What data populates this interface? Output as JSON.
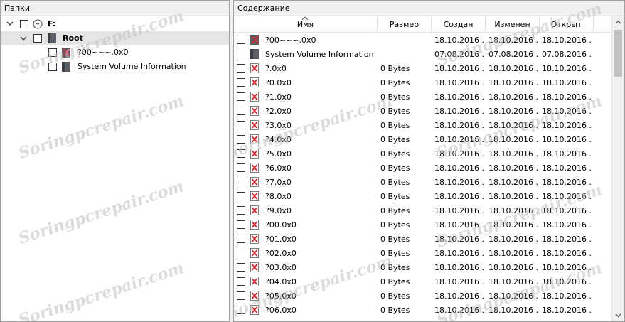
{
  "folders_pane": {
    "title": "Папки",
    "tree": [
      {
        "label": "F:",
        "level": 0,
        "icon": "drive-icon",
        "bold": true
      },
      {
        "label": "Root",
        "level": 1,
        "icon": "folder-icon",
        "bold": true,
        "selected": true
      },
      {
        "label": "?00~~~.0x0",
        "level": 2,
        "icon": "deleted-folder-icon",
        "bold": false
      },
      {
        "label": "System Volume Information",
        "level": 2,
        "icon": "folder-icon",
        "bold": false
      }
    ]
  },
  "content_pane": {
    "title": "Содержание",
    "columns": {
      "name": "Имя",
      "size": "Размер",
      "created": "Создан",
      "modified": "Изменен",
      "opened": "Открыт"
    },
    "rows": [
      {
        "name": "?00~~~.0x0",
        "size": "",
        "created": "18.10.2016 ...",
        "modified": "18.10.2016 ...",
        "opened": "18.10.2016 ...",
        "icon": "deleted-folder-icon"
      },
      {
        "name": "System Volume Information",
        "size": "",
        "created": "07.08.2016 ...",
        "modified": "07.08.2016 ...",
        "opened": "07.08.2016 ...",
        "icon": "folder-icon"
      },
      {
        "name": "?.0x0",
        "size": "0 Bytes",
        "created": "18.10.2016 ...",
        "modified": "18.10.2016 ...",
        "opened": "18.10.2016 ...",
        "icon": "deleted-file-icon"
      },
      {
        "name": "?0.0x0",
        "size": "0 Bytes",
        "created": "18.10.2016 ...",
        "modified": "18.10.2016 ...",
        "opened": "18.10.2016 ...",
        "icon": "deleted-file-icon"
      },
      {
        "name": "?1.0x0",
        "size": "0 Bytes",
        "created": "18.10.2016 ...",
        "modified": "18.10.2016 ...",
        "opened": "18.10.2016 ...",
        "icon": "deleted-file-icon"
      },
      {
        "name": "?2.0x0",
        "size": "0 Bytes",
        "created": "18.10.2016 ...",
        "modified": "18.10.2016 ...",
        "opened": "18.10.2016 ...",
        "icon": "deleted-file-icon"
      },
      {
        "name": "?3.0x0",
        "size": "0 Bytes",
        "created": "18.10.2016 ...",
        "modified": "18.10.2016 ...",
        "opened": "18.10.2016 ...",
        "icon": "deleted-file-icon"
      },
      {
        "name": "?4.0x0",
        "size": "0 Bytes",
        "created": "18.10.2016 ...",
        "modified": "18.10.2016 ...",
        "opened": "18.10.2016 ...",
        "icon": "deleted-file-icon"
      },
      {
        "name": "?5.0x0",
        "size": "0 Bytes",
        "created": "18.10.2016 ...",
        "modified": "18.10.2016 ...",
        "opened": "18.10.2016 ...",
        "icon": "deleted-file-icon"
      },
      {
        "name": "?6.0x0",
        "size": "0 Bytes",
        "created": "18.10.2016 ...",
        "modified": "18.10.2016 ...",
        "opened": "18.10.2016 ...",
        "icon": "deleted-file-icon"
      },
      {
        "name": "?7.0x0",
        "size": "0 Bytes",
        "created": "18.10.2016 ...",
        "modified": "18.10.2016 ...",
        "opened": "18.10.2016 ...",
        "icon": "deleted-file-icon"
      },
      {
        "name": "?8.0x0",
        "size": "0 Bytes",
        "created": "18.10.2016 ...",
        "modified": "18.10.2016 ...",
        "opened": "18.10.2016 ...",
        "icon": "deleted-file-icon"
      },
      {
        "name": "?9.0x0",
        "size": "0 Bytes",
        "created": "18.10.2016 ...",
        "modified": "18.10.2016 ...",
        "opened": "18.10.2016 ...",
        "icon": "deleted-file-icon"
      },
      {
        "name": "?00.0x0",
        "size": "0 Bytes",
        "created": "18.10.2016 ...",
        "modified": "18.10.2016 ...",
        "opened": "18.10.2016 ...",
        "icon": "deleted-file-icon"
      },
      {
        "name": "?01.0x0",
        "size": "0 Bytes",
        "created": "18.10.2016 ...",
        "modified": "18.10.2016 ...",
        "opened": "18.10.2016 ...",
        "icon": "deleted-file-icon"
      },
      {
        "name": "?02.0x0",
        "size": "0 Bytes",
        "created": "18.10.2016 ...",
        "modified": "18.10.2016 ...",
        "opened": "18.10.2016 ...",
        "icon": "deleted-file-icon"
      },
      {
        "name": "?03.0x0",
        "size": "0 Bytes",
        "created": "18.10.2016 ...",
        "modified": "18.10.2016 ...",
        "opened": "18.10.2016 ...",
        "icon": "deleted-file-icon"
      },
      {
        "name": "?04.0x0",
        "size": "0 Bytes",
        "created": "18.10.2016 ...",
        "modified": "18.10.2016 ...",
        "opened": "18.10.2016 ...",
        "icon": "deleted-file-icon"
      },
      {
        "name": "?05.0x0",
        "size": "0 Bytes",
        "created": "18.10.2016 ...",
        "modified": "18.10.2016 ...",
        "opened": "18.10.2016 ...",
        "icon": "deleted-file-icon"
      },
      {
        "name": "?06.0x0",
        "size": "0 Bytes",
        "created": "18.10.2016 ...",
        "modified": "18.10.2016 ...",
        "opened": "18.10.2016 ...",
        "icon": "deleted-file-icon"
      }
    ]
  },
  "watermark": "Soringpcrepair.com"
}
